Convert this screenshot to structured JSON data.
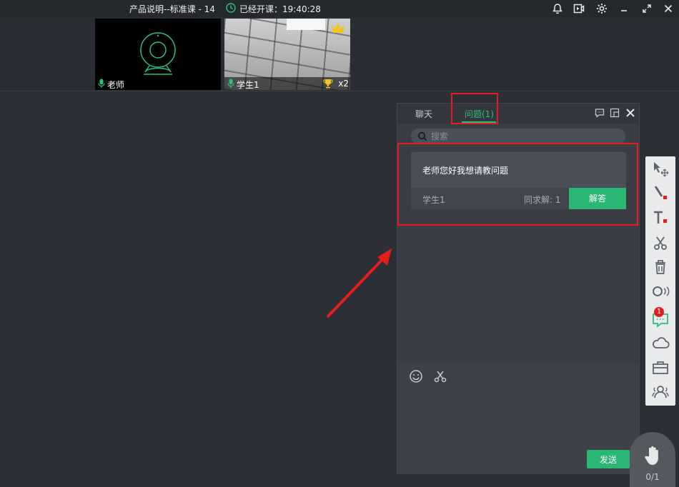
{
  "window": {
    "title": "产品说明--标准课 - 14",
    "class_time": "已经开课：19:40:28"
  },
  "videos": {
    "teacher": {
      "name": "老师"
    },
    "student": {
      "name": "学生1",
      "trophy_count": "x2"
    }
  },
  "panel": {
    "tabs": [
      {
        "label": "聊天",
        "active": false
      },
      {
        "label": "问题(1)",
        "active": true
      }
    ],
    "search_placeholder": "搜索",
    "question": {
      "text": "老师您好我想请教问题",
      "student": "学生1",
      "same_question": "同求解: 1",
      "answer_label": "解答"
    },
    "send_label": "发送"
  },
  "toolbar": {
    "items": [
      "select-move-icon",
      "pen-icon",
      "text-icon",
      "scissors-icon",
      "trash-icon",
      "laser-pointer-icon",
      "question-icon",
      "cloud-icon",
      "toolbox-icon",
      "users-icon"
    ],
    "question_badge": "1"
  },
  "raise_hand": {
    "count": "0/1"
  },
  "colors": {
    "accent": "#2ab673",
    "highlight": "#e51c1c",
    "background": "#2c2f35"
  }
}
